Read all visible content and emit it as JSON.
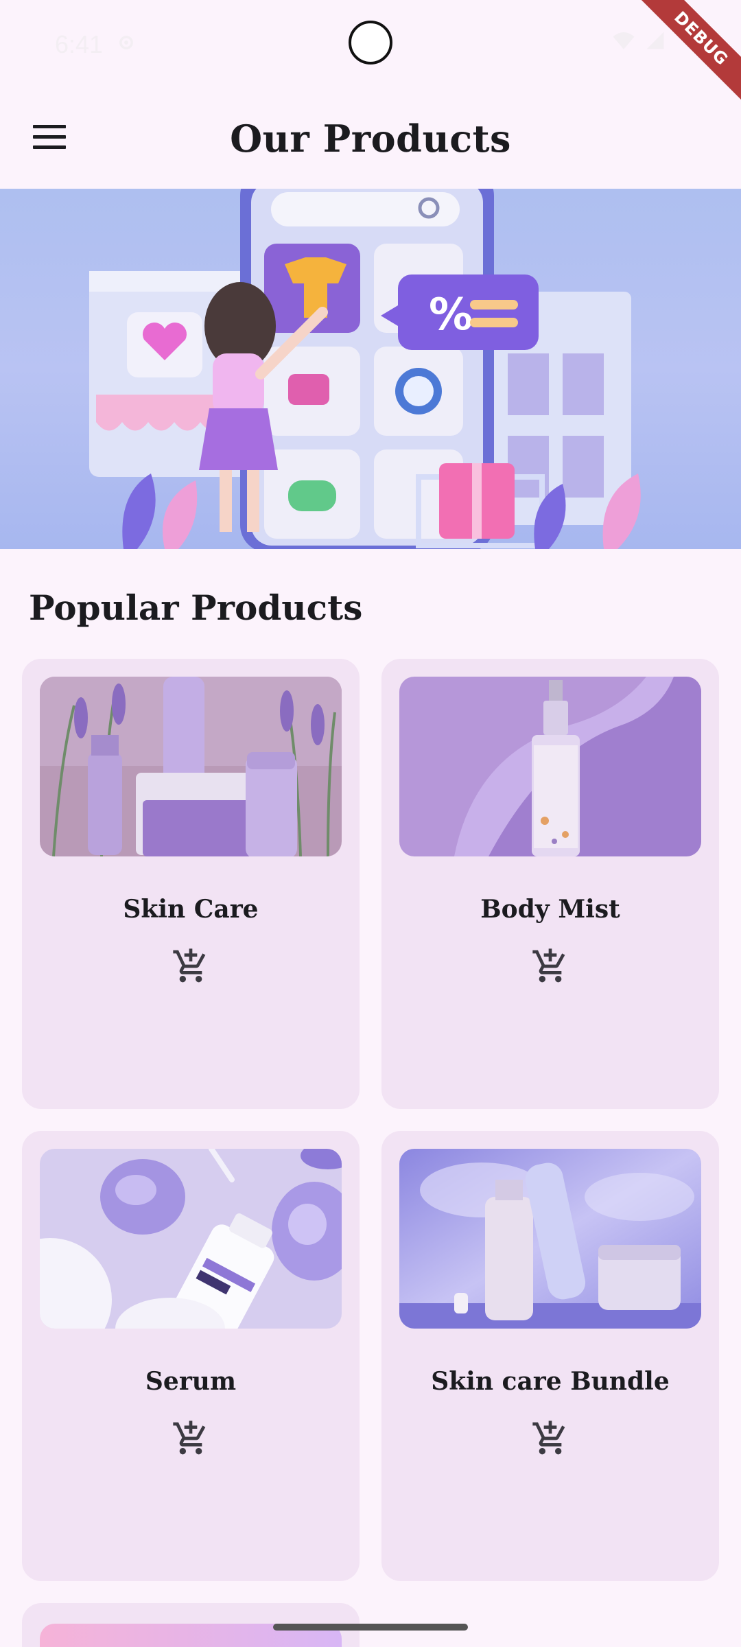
{
  "status_bar": {
    "time": "6:41"
  },
  "debug_label": "DEBUG",
  "app_bar": {
    "title": "Our Products",
    "menu_icon": "hamburger-menu-icon"
  },
  "section": {
    "title": "Popular Products"
  },
  "products": [
    {
      "title": "Skin Care",
      "icon": "add-shopping-cart-icon"
    },
    {
      "title": "Body Mist",
      "icon": "add-shopping-cart-icon"
    },
    {
      "title": "Serum",
      "icon": "add-shopping-cart-icon"
    },
    {
      "title": "Skin care Bundle",
      "icon": "add-shopping-cart-icon"
    }
  ],
  "colors": {
    "background": "#fcf3fc",
    "card": "#f2e3f4",
    "text": "#1b1b1f",
    "accent": "#9b7fd6"
  }
}
